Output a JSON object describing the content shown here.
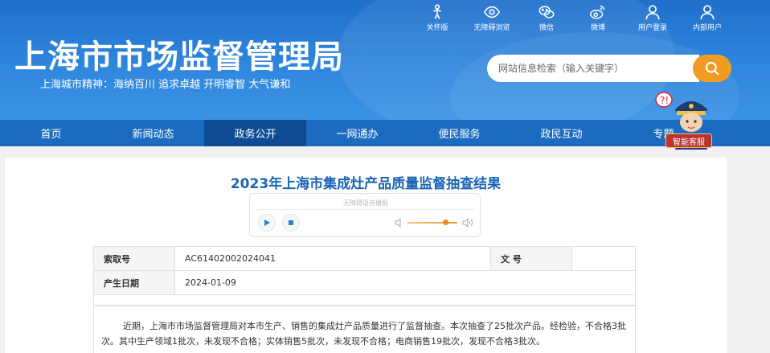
{
  "header": {
    "site_title": "上海市市场监督管理局",
    "slogan": "上海城市精神：海纳百川   追求卓越   开明睿智   大气谦和",
    "top_links": [
      {
        "label": "关怀版",
        "icon": "care-icon"
      },
      {
        "label": "无障碍浏览",
        "icon": "eye-icon"
      },
      {
        "label": "微信",
        "icon": "wechat-icon"
      },
      {
        "label": "微博",
        "icon": "weibo-icon"
      },
      {
        "label": "用户登录",
        "icon": "user-icon"
      },
      {
        "label": "内部用户",
        "icon": "user-icon"
      }
    ],
    "search_placeholder": "网站信息检索（输入关键字）"
  },
  "nav": {
    "items": [
      "首页",
      "新闻动态",
      "政务公开",
      "一网通办",
      "便民服务",
      "政民互动",
      "专题"
    ],
    "active_index": 2
  },
  "assistant": {
    "label": "智能客服"
  },
  "article": {
    "title": "2023年上海市集成灶产品质量监督抽查结果",
    "player_label": "无障碍语音播报",
    "volume_level": 0.75,
    "meta": {
      "index_key": "索取号",
      "index_value": "AC61402002024041",
      "doc_key": "文  号",
      "doc_value": "",
      "date_key": "产生日期",
      "date_value": "2024-01-09"
    },
    "body": "近期，上海市市场监督管理局对本市生产、销售的集成灶产品质量进行了监督抽查。本次抽查了25批次产品。经检验，不合格3批次。其中生产领域1批次，未发现不合格；实体销售5批次，未发现不合格；电商销售19批次，发现不合格3批次。"
  },
  "colors": {
    "header_blue": "#2f86dd",
    "nav_blue": "#1b6cc1",
    "nav_active": "#0e4d94",
    "title_blue": "#1a64b4",
    "search_orange": "#f29b23"
  }
}
